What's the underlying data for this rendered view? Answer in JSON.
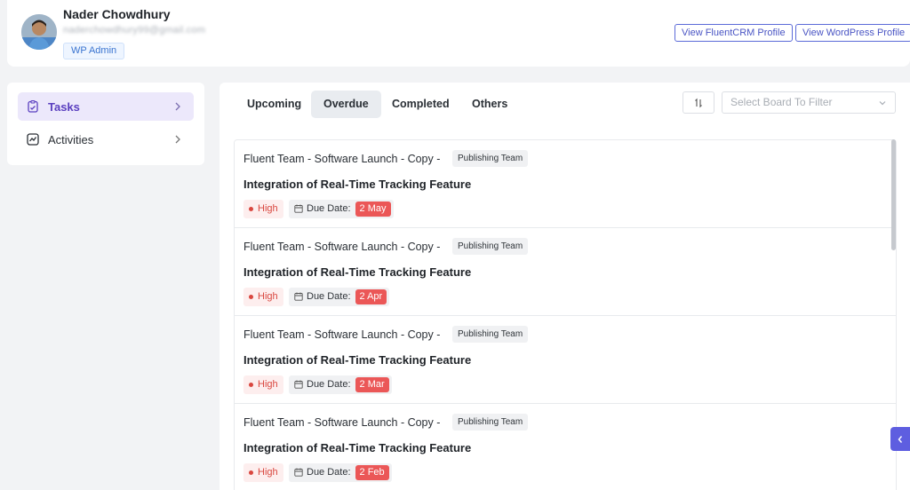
{
  "profile": {
    "name": "Nader Chowdhury",
    "email": "naderchowdhury99@gmail.com",
    "role_badge": "WP Admin",
    "view_crm_label": "View FluentCRM Profile",
    "view_wp_label": "View WordPress Profile"
  },
  "sidebar": {
    "items": [
      {
        "label": "Tasks",
        "icon": "clipboard-icon",
        "active": true
      },
      {
        "label": "Activities",
        "icon": "activity-chart-icon",
        "active": false
      }
    ]
  },
  "tabs": [
    {
      "label": "Upcoming",
      "active": false
    },
    {
      "label": "Overdue",
      "active": true
    },
    {
      "label": "Completed",
      "active": false
    },
    {
      "label": "Others",
      "active": false
    }
  ],
  "filter": {
    "placeholder": "Select Board To Filter"
  },
  "tasks": [
    {
      "path": "Fluent Team - Software Launch - Copy -",
      "team": "Publishing Team",
      "title": "Integration of Real-Time Tracking Feature",
      "priority": "High",
      "due_label": "Due Date:",
      "due_date": "2 May"
    },
    {
      "path": "Fluent Team - Software Launch - Copy -",
      "team": "Publishing Team",
      "title": "Integration of Real-Time Tracking Feature",
      "priority": "High",
      "due_label": "Due Date:",
      "due_date": "2 Apr"
    },
    {
      "path": "Fluent Team - Software Launch - Copy -",
      "team": "Publishing Team",
      "title": "Integration of Real-Time Tracking Feature",
      "priority": "High",
      "due_label": "Due Date:",
      "due_date": "2 Mar"
    },
    {
      "path": "Fluent Team - Software Launch - Copy -",
      "team": "Publishing Team",
      "title": "Integration of Real-Time Tracking Feature",
      "priority": "High",
      "due_label": "Due Date:",
      "due_date": "2 Feb"
    }
  ],
  "colors": {
    "accent": "#5a3fbf",
    "overdue": "#eb5757",
    "high_priority": "#d9473f"
  }
}
